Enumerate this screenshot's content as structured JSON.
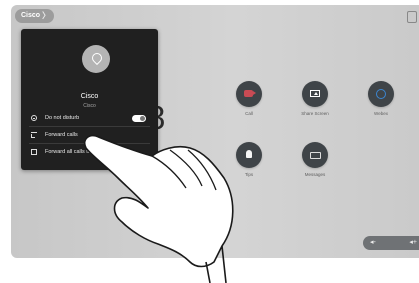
{
  "topbar": {
    "brand": "Cisco",
    "chevron": "〉"
  },
  "clock_fragment": "8",
  "panel": {
    "name": "Cisco",
    "subtitle": "Cisco",
    "items": [
      {
        "label": "Do not disturb",
        "icon": "dnd-icon",
        "toggle": true
      },
      {
        "label": "Forward calls",
        "icon": "forward-icon"
      },
      {
        "label": "Forward all calls to v...",
        "icon": "forward-all-icon"
      }
    ]
  },
  "tiles": [
    {
      "label": "Call",
      "icon": "call-icon"
    },
    {
      "label": "Share Screen",
      "icon": "share-screen-icon"
    },
    {
      "label": "Webex",
      "icon": "webex-icon"
    },
    {
      "label": "Tips",
      "icon": "tips-icon"
    },
    {
      "label": "Messages",
      "icon": "messages-icon"
    }
  ],
  "volume": {
    "down": "◂-",
    "up": "◂+"
  },
  "colors": {
    "panel": "#202020",
    "tile": "#3f4448",
    "call_accent": "#c94b54",
    "webex_accent": "#3b86d1"
  }
}
